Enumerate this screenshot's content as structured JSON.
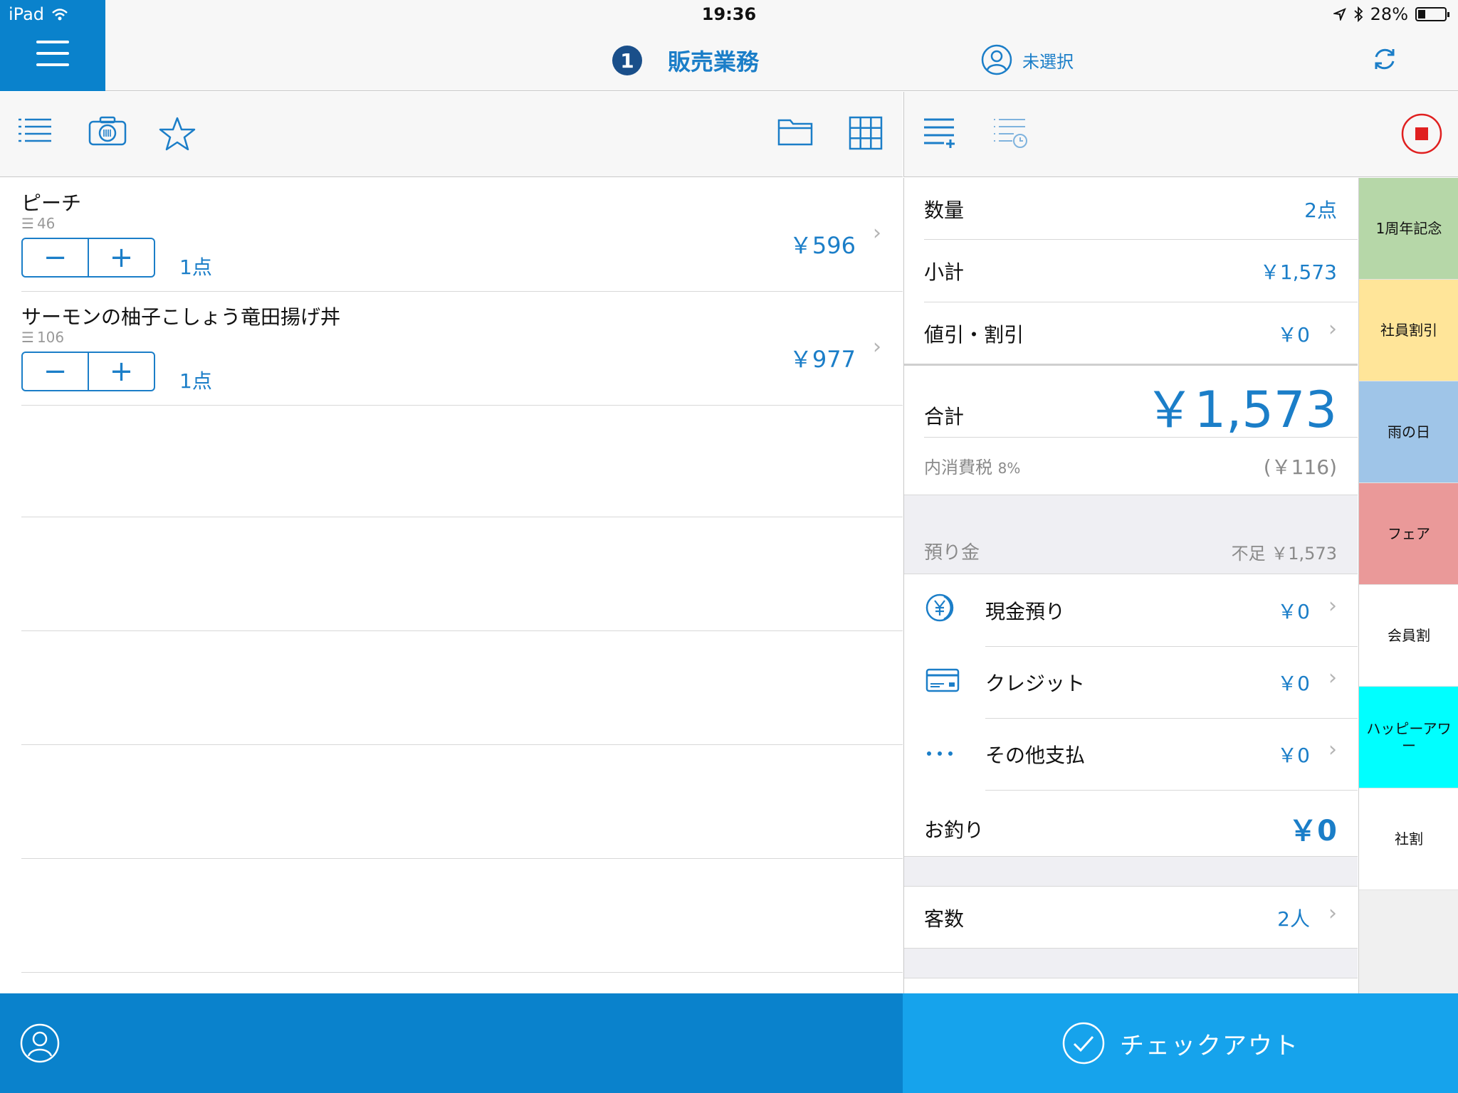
{
  "status_bar": {
    "device": "iPad",
    "time": "19:36",
    "battery": "28%"
  },
  "header": {
    "badge": "1",
    "title": "販売業務",
    "staff": "未選択"
  },
  "items": [
    {
      "name": "ピーチ",
      "stock": "46",
      "qty": "1点",
      "price": "￥596"
    },
    {
      "name": "サーモンの柚子こしょう竜田揚げ丼",
      "stock": "106",
      "qty": "1点",
      "price": "￥977"
    }
  ],
  "stepper": {
    "minus": "−",
    "plus": "+"
  },
  "summary": {
    "quantity_label": "数量",
    "quantity_value": "2点",
    "subtotal_label": "小計",
    "subtotal_value": "￥1,573",
    "discount_label": "値引・割引",
    "discount_value": "￥0",
    "total_label": "合計",
    "total_value": "￥1,573",
    "tax_label": "内消費税",
    "tax_rate": "8%",
    "tax_value": "(￥116)",
    "deposit_label": "預り金",
    "deposit_value": "不足 ￥1,573",
    "cash_label": "現金預り",
    "cash_value": "￥0",
    "credit_label": "クレジット",
    "credit_value": "￥0",
    "other_label": "その他支払",
    "other_value": "￥0",
    "change_label": "お釣り",
    "change_value": "￥0",
    "guests_label": "客数",
    "guests_value": "2人"
  },
  "tags": [
    {
      "label": "1周年記念",
      "color": "#b6d7a8"
    },
    {
      "label": "社員割引",
      "color": "#ffe599"
    },
    {
      "label": "雨の日",
      "color": "#9fc5e8"
    },
    {
      "label": "フェア",
      "color": "#ea9999"
    },
    {
      "label": "会員割",
      "color": "#ffffff"
    },
    {
      "label": "ハッピーアワー",
      "color": "#00ffff"
    },
    {
      "label": "社割",
      "color": "#ffffff"
    }
  ],
  "footer": {
    "checkout_label": "チェックアウト"
  },
  "colors": {
    "accent": "#1b7ec8",
    "header_blue": "#0a82cc",
    "checkout_blue": "#16a3ec",
    "stop_red": "#e02020"
  }
}
